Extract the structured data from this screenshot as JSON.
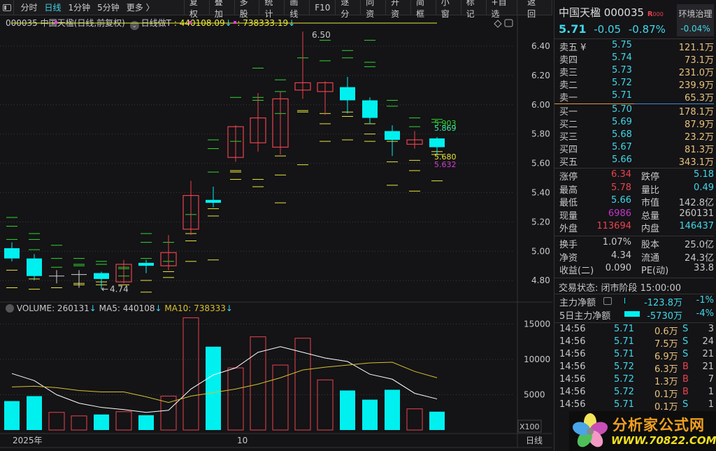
{
  "toolbar": {
    "left": [
      "分时",
      "日线",
      "1分钟",
      "5分钟",
      "更多 〉"
    ],
    "active": "日线",
    "buttons": [
      "复权",
      "叠加",
      "多股",
      "统计",
      "画线",
      "F10",
      "逐分",
      "同资",
      "开资",
      "简框",
      "小窗",
      "标记",
      "+自选",
      "返回"
    ]
  },
  "info": {
    "code": "000035",
    "name": "中国天楹",
    "mode": "(日线,前复权)",
    "indicator": "日线做T",
    "v1": "440108.09",
    "v2": "738333.19",
    "arrow": "↓",
    "sep": ":"
  },
  "colors": {
    "up": "#e8434e",
    "down": "#00f0f0",
    "bg": "#141316",
    "ma5": "#ffffff",
    "ma10": "#d6c12e"
  },
  "price_axis": [
    "6.40",
    "6.20",
    "6.00",
    "5.80",
    "5.60",
    "5.40",
    "5.20",
    "5.00",
    "4.80"
  ],
  "annotations": {
    "high": "6.50",
    "low": "4.74",
    "last_green1": "5.903",
    "last_green2": "5.869",
    "last_yellow": "5.680",
    "last_magenta": "5.632"
  },
  "chart_data": {
    "type": "candlestick",
    "ohlc": [
      [
        5.02,
        5.06,
        4.93,
        4.95
      ],
      [
        4.95,
        4.98,
        4.8,
        4.83
      ],
      [
        4.83,
        4.87,
        4.78,
        4.83
      ],
      [
        4.84,
        4.87,
        4.75,
        4.84
      ],
      [
        4.85,
        4.86,
        4.74,
        4.81
      ],
      [
        4.79,
        4.94,
        4.78,
        4.91
      ],
      [
        4.92,
        4.94,
        4.85,
        4.9
      ],
      [
        4.9,
        5.11,
        4.87,
        4.99
      ],
      [
        5.15,
        5.48,
        5.11,
        5.38
      ],
      [
        5.35,
        5.44,
        5.3,
        5.33
      ],
      [
        5.64,
        5.86,
        5.61,
        5.85
      ],
      [
        5.74,
        6.08,
        5.68,
        5.91
      ],
      [
        5.71,
        6.09,
        5.66,
        6.04
      ],
      [
        6.1,
        6.5,
        6.04,
        6.15
      ],
      [
        6.09,
        6.16,
        5.93,
        6.15
      ],
      [
        6.12,
        6.19,
        5.94,
        6.03
      ],
      [
        6.03,
        6.05,
        5.87,
        5.91
      ],
      [
        5.82,
        5.86,
        5.65,
        5.76
      ],
      [
        5.73,
        5.82,
        5.7,
        5.76
      ],
      [
        5.77,
        5.78,
        5.66,
        5.71
      ]
    ],
    "green_levels": [
      [
        5.23,
        5.17,
        5.08
      ],
      [
        5.12,
        5.08,
        5.01
      ],
      [
        5.04,
        4.95,
        4.89
      ],
      [
        4.95,
        4.91,
        4.9
      ],
      [
        4.93,
        4.91
      ],
      [
        4.89,
        4.88,
        4.83
      ],
      [
        5.12,
        5.06,
        4.95
      ],
      [
        5.06,
        4.93,
        4.9
      ],
      [
        5.25
      ],
      [
        5.76,
        5.7,
        5.54
      ],
      [
        6.05,
        5.75
      ],
      [
        6.25,
        6.05,
        6.03
      ],
      [
        6.17,
        6.09,
        5.94
      ],
      [
        6.32
      ],
      [
        6.44,
        6.3
      ],
      [
        6.37,
        6.32
      ],
      [
        6.44,
        6.29,
        6.26
      ],
      [
        6.03,
        5.99
      ],
      [
        5.91,
        5.85
      ],
      [
        5.9,
        5.88
      ]
    ],
    "yellow_levels": [
      [
        4.87,
        4.75
      ],
      [
        4.81,
        4.74
      ],
      [
        4.75
      ],
      [
        4.78,
        4.77
      ],
      [
        4.79,
        4.77
      ],
      [
        4.77
      ],
      [
        4.8,
        4.72
      ],
      [
        4.86,
        4.82
      ],
      [
        5.12,
        5.07,
        4.93
      ],
      [
        5.29,
        5.24,
        4.94
      ],
      [
        5.55,
        5.54,
        5.49
      ],
      [
        5.49,
        5.44
      ],
      [
        5.65,
        5.52,
        5.33
      ],
      [
        5.96,
        5.95,
        5.59
      ],
      [
        5.94,
        5.87,
        5.75
      ],
      [
        5.95,
        5.92,
        5.76
      ],
      [
        5.87,
        5.8,
        5.75
      ],
      [
        5.75,
        5.61,
        5.45
      ],
      [
        5.62,
        5.55,
        5.41
      ],
      [
        5.68,
        5.66,
        5.48
      ]
    ],
    "ref_line": 6.5,
    "volume": [
      4100,
      4800,
      2500,
      2000,
      2200,
      2600,
      2100,
      4800,
      15900,
      11800,
      8800,
      13200,
      9200,
      13000,
      7100,
      5600,
      4300,
      5700,
      3000,
      2601
    ],
    "ma5": [
      8000,
      7000,
      5000,
      3800,
      3200,
      2900,
      2500,
      2800,
      5800,
      7800,
      8800,
      11000,
      11800,
      11000,
      10200,
      9700,
      7900,
      7200,
      5200,
      4400
    ],
    "ma10": [
      6100,
      6200,
      6000,
      5600,
      5400,
      5400,
      4700,
      3900,
      4800,
      5300,
      5800,
      6500,
      7400,
      8500,
      8900,
      9200,
      9500,
      9600,
      8300,
      7400
    ],
    "price_range": [
      4.7,
      6.55
    ],
    "volume_axis": [
      "15000",
      "10000",
      "5000"
    ],
    "volume_unit": "X100",
    "x_labels": [
      {
        "label": "2025年",
        "index": 0
      },
      {
        "label": "10",
        "index": 10
      }
    ],
    "period": "日线"
  },
  "volume_header": {
    "volume": "VOLUME: 260131",
    "ma5": "MA5: 440108",
    "ma10": "MA10: 738333",
    "arrow": "↓"
  },
  "quote": {
    "name": "中国天楹",
    "code": "000035",
    "badge": "R",
    "badge2": "000",
    "price": "5.71",
    "change": "-0.05",
    "pct": "-0.87%",
    "sector": "环境治理",
    "sector_pct": "-0.04%"
  },
  "asks": [
    {
      "label": "卖五 ¥",
      "price": "5.75",
      "vol": "121.1万"
    },
    {
      "label": "卖四",
      "price": "5.74",
      "vol": "73.1万"
    },
    {
      "label": "卖三",
      "price": "5.73",
      "vol": "231.0万"
    },
    {
      "label": "卖二",
      "price": "5.72",
      "vol": "239.9万"
    },
    {
      "label": "卖一",
      "price": "5.71",
      "vol": "65.3万"
    }
  ],
  "bids": [
    {
      "label": "买一",
      "price": "5.70",
      "vol": "178.1万"
    },
    {
      "label": "买二",
      "price": "5.69",
      "vol": "87.9万"
    },
    {
      "label": "买三",
      "price": "5.68",
      "vol": "23.2万"
    },
    {
      "label": "买四",
      "price": "5.67",
      "vol": "81.3万"
    },
    {
      "label": "买五",
      "price": "5.66",
      "vol": "343.1万"
    }
  ],
  "stats1": [
    [
      "涨停",
      "6.34",
      "r",
      "跌停",
      "5.18",
      "c"
    ],
    [
      "最高",
      "5.78",
      "r",
      "量比",
      "0.49",
      "c"
    ],
    [
      "最低",
      "5.66",
      "c",
      "市值",
      "142.8亿",
      "g"
    ],
    [
      "现量",
      "6986",
      "m",
      "总量",
      "260131",
      "g"
    ],
    [
      "外盘",
      "113694",
      "r",
      "内盘",
      "146437",
      "c"
    ]
  ],
  "stats2": [
    [
      "换手",
      "1.07%",
      "g",
      "股本",
      "25.0亿",
      "g"
    ],
    [
      "净资",
      "4.34",
      "g",
      "流通",
      "24.3亿",
      "g"
    ],
    [
      "收益(二)",
      "0.090",
      "g",
      "PE(动)",
      "33.8",
      "g"
    ]
  ],
  "status": "交易状态: 闭市阶段 15:00:00",
  "flow": [
    {
      "label": "主力净额",
      "value": "-123.8万",
      "pct": "-1%"
    },
    {
      "label": "5日主力净额",
      "value": "-5730万",
      "pct": "-4%"
    }
  ],
  "ticks": [
    [
      "14:56",
      "5.71",
      "0.6万",
      "S",
      "3"
    ],
    [
      "14:56",
      "5.71",
      "7.5万",
      "S",
      "24"
    ],
    [
      "14:56",
      "5.71",
      "6.9万",
      "S",
      "21"
    ],
    [
      "14:56",
      "5.72",
      "6.3万",
      "B",
      "21"
    ],
    [
      "14:56",
      "5.72",
      "1.3万",
      "B",
      "7"
    ],
    [
      "14:56",
      "5.72",
      "0.1万",
      "B",
      "1"
    ],
    [
      "14:56",
      "5.71",
      "0.1万",
      "S",
      "1"
    ]
  ],
  "watermark": {
    "title": "分析家公式网",
    "url": "WWW.70822.COM"
  }
}
